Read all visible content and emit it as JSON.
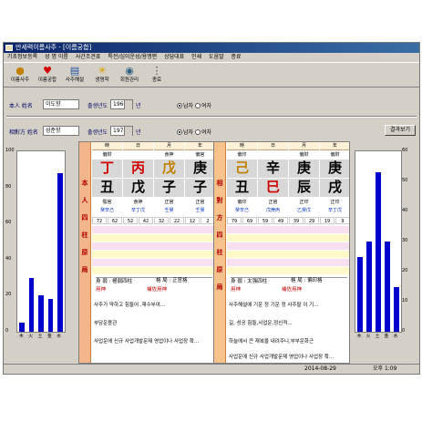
{
  "window": {
    "title": "만세력이름사주 - [이름궁합]"
  },
  "menu": [
    "기초정보등록",
    "성 명 이름",
    "사간조견표",
    "특전/십이운성/용맹편",
    "상담대표",
    "인쇄",
    "도움말",
    "종료"
  ],
  "toolbar": [
    {
      "icon": "coins-icon",
      "label": "이름사주"
    },
    {
      "icon": "heart-icon",
      "label": "이름궁합"
    },
    {
      "icon": "document-icon",
      "label": "사주해설"
    },
    {
      "icon": "sun-icon",
      "label": "생명학"
    },
    {
      "icon": "eye-icon",
      "label": "회원관리"
    },
    {
      "icon": "dots-icon",
      "label": "종료"
    }
  ],
  "person1": {
    "name_label": "本人 姓名",
    "name": "이도향",
    "year_label": "출생년도",
    "year": "1960",
    "year_suffix": "년",
    "male": "남자",
    "female": "여자"
  },
  "person2": {
    "name_label": "相對方 姓名",
    "name": "성준향",
    "year_label": "출생년도",
    "year": "1970",
    "year_suffix": "년",
    "male": "남자",
    "female": "여자"
  },
  "result_button": "결과보기",
  "left_chart": {
    "ymax": 100,
    "ticks": [
      "100",
      "80",
      "60",
      "40",
      "20",
      "0"
    ],
    "categories": [
      "木",
      "火",
      "土",
      "金",
      "水"
    ],
    "values": [
      5,
      30,
      20,
      18,
      88
    ]
  },
  "right_chart": {
    "ymax": 60,
    "ticks": [
      "60",
      "50",
      "40",
      "30",
      "20",
      "10",
      "0"
    ],
    "categories": [
      "木",
      "火",
      "土",
      "金",
      "水"
    ],
    "values": [
      25,
      30,
      53,
      30,
      15
    ]
  },
  "left_panel": {
    "strip": [
      "本",
      "人",
      "四",
      "柱",
      "原",
      "局"
    ],
    "headers": [
      "時",
      "日",
      "月",
      "年"
    ],
    "top": [
      "偏財",
      "",
      "食神",
      "偏官"
    ],
    "stems": [
      "丁",
      "丙",
      "戊",
      "庚"
    ],
    "branches": [
      "丑",
      "戊",
      "子",
      "子"
    ],
    "sub": [
      "傷官",
      "食神",
      "正官",
      "正官"
    ],
    "hidden": [
      "癸辛己",
      "辛丁戊",
      "壬癸",
      "壬癸"
    ],
    "nums": [
      "72",
      "62",
      "52",
      "42",
      "32",
      "22",
      "12",
      "2"
    ],
    "line1": "身 弱 : 極弱四柱",
    "line2": "格 局 : 正官格",
    "line3": "用神",
    "line4": "補佐用神",
    "body1": "사주가 약하고 힘들어 ,재수부여...",
    "body2": "부담운용관",
    "body3": "사업운에 신규 사업개발문제 영업이나 사업장 확..."
  },
  "right_panel": {
    "strip": [
      "相",
      "對",
      "方",
      "四",
      "柱",
      "原",
      "局"
    ],
    "headers": [
      "時",
      "日",
      "月",
      "年"
    ],
    "top": [
      "偏印",
      "",
      "偏財",
      "偏財"
    ],
    "stems": [
      "己",
      "辛",
      "庚",
      "庚"
    ],
    "branches": [
      "丑",
      "巳",
      "辰",
      "戌"
    ],
    "sub": [
      "偏印",
      "正官",
      "正印",
      "正印"
    ],
    "hidden": [
      "癸辛己",
      "戊庚丙",
      "乙癸戊",
      "辛丁戊"
    ],
    "nums": [
      "79",
      "69",
      "59",
      "49",
      "39",
      "29",
      "19",
      "9"
    ],
    "line1": "身 弱 : 太强四柱",
    "line2": "格 局 : 偏印格",
    "line3": "用神",
    "line4": "補佐用神",
    "body1": "사주해설에 기운 정 기운 정 사주팔 이 기...",
    "body2": "길, 성공 힘들,사업운,정신적...",
    "body3": "하늘에서 큰 재복을 내려주니,부부운화근",
    "body4": "사업운에 신규 사업개발문제 영업이나 사업장 확..."
  },
  "status": {
    "date": "2014-08-29",
    "time": "오후 1:09"
  }
}
